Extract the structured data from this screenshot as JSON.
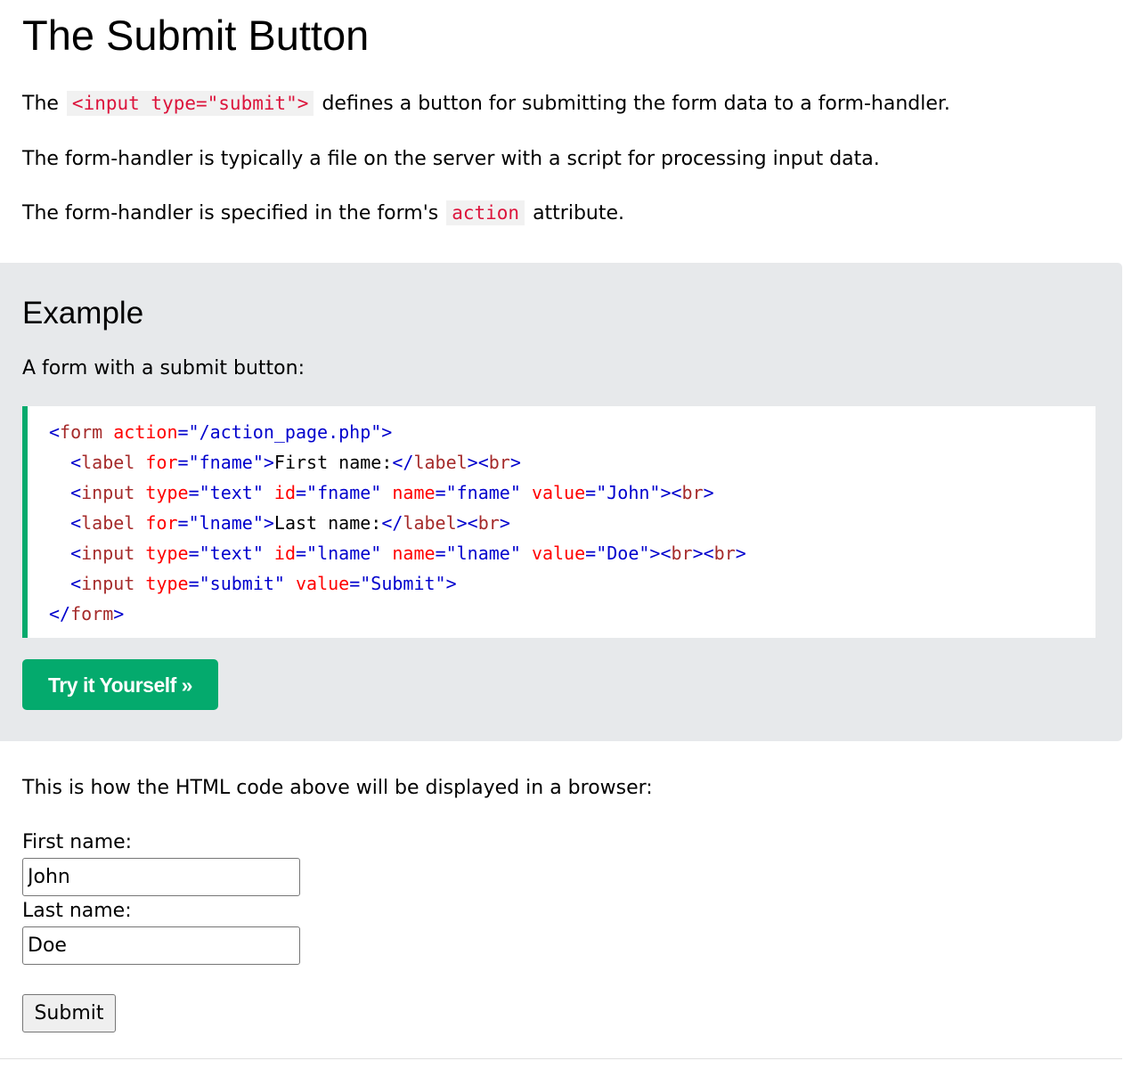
{
  "title": "The Submit Button",
  "intro": {
    "p1": {
      "before": "The",
      "code": "<input type=\"submit\">",
      "after": "defines a button for submitting the form data to a form-handler."
    },
    "p2": "The form-handler is typically a file on the server with a script for processing input data.",
    "p3": {
      "before": "The form-handler is specified in the form's",
      "code": "action",
      "after": "attribute."
    }
  },
  "example": {
    "heading": "Example",
    "description": "A form with a submit button:",
    "try_button": "Try it Yourself »",
    "code_lines": [
      {
        "indent": "",
        "tokens": [
          {
            "t": "tag",
            "v": "<"
          },
          {
            "t": "tname",
            "v": "form"
          },
          {
            "t": "text",
            "v": " "
          },
          {
            "t": "attr",
            "v": "action"
          },
          {
            "t": "tag",
            "v": "=\"/action_page.php\">"
          }
        ]
      },
      {
        "indent": "  ",
        "tokens": [
          {
            "t": "tag",
            "v": "<"
          },
          {
            "t": "tname",
            "v": "label"
          },
          {
            "t": "text",
            "v": " "
          },
          {
            "t": "attr",
            "v": "for"
          },
          {
            "t": "tag",
            "v": "=\"fname\">"
          },
          {
            "t": "text",
            "v": "First name:"
          },
          {
            "t": "tag",
            "v": "</"
          },
          {
            "t": "tname",
            "v": "label"
          },
          {
            "t": "tag",
            "v": "><"
          },
          {
            "t": "tname",
            "v": "br"
          },
          {
            "t": "tag",
            "v": ">"
          }
        ]
      },
      {
        "indent": "  ",
        "tokens": [
          {
            "t": "tag",
            "v": "<"
          },
          {
            "t": "tname",
            "v": "input"
          },
          {
            "t": "text",
            "v": " "
          },
          {
            "t": "attr",
            "v": "type"
          },
          {
            "t": "tag",
            "v": "=\"text\""
          },
          {
            "t": "text",
            "v": " "
          },
          {
            "t": "attr",
            "v": "id"
          },
          {
            "t": "tag",
            "v": "=\"fname\""
          },
          {
            "t": "text",
            "v": " "
          },
          {
            "t": "attr",
            "v": "name"
          },
          {
            "t": "tag",
            "v": "=\"fname\""
          },
          {
            "t": "text",
            "v": " "
          },
          {
            "t": "attr",
            "v": "value"
          },
          {
            "t": "tag",
            "v": "=\"John\"><"
          },
          {
            "t": "tname",
            "v": "br"
          },
          {
            "t": "tag",
            "v": ">"
          }
        ]
      },
      {
        "indent": "  ",
        "tokens": [
          {
            "t": "tag",
            "v": "<"
          },
          {
            "t": "tname",
            "v": "label"
          },
          {
            "t": "text",
            "v": " "
          },
          {
            "t": "attr",
            "v": "for"
          },
          {
            "t": "tag",
            "v": "=\"lname\">"
          },
          {
            "t": "text",
            "v": "Last name:"
          },
          {
            "t": "tag",
            "v": "</"
          },
          {
            "t": "tname",
            "v": "label"
          },
          {
            "t": "tag",
            "v": "><"
          },
          {
            "t": "tname",
            "v": "br"
          },
          {
            "t": "tag",
            "v": ">"
          }
        ]
      },
      {
        "indent": "  ",
        "tokens": [
          {
            "t": "tag",
            "v": "<"
          },
          {
            "t": "tname",
            "v": "input"
          },
          {
            "t": "text",
            "v": " "
          },
          {
            "t": "attr",
            "v": "type"
          },
          {
            "t": "tag",
            "v": "=\"text\""
          },
          {
            "t": "text",
            "v": " "
          },
          {
            "t": "attr",
            "v": "id"
          },
          {
            "t": "tag",
            "v": "=\"lname\""
          },
          {
            "t": "text",
            "v": " "
          },
          {
            "t": "attr",
            "v": "name"
          },
          {
            "t": "tag",
            "v": "=\"lname\""
          },
          {
            "t": "text",
            "v": " "
          },
          {
            "t": "attr",
            "v": "value"
          },
          {
            "t": "tag",
            "v": "=\"Doe\"><"
          },
          {
            "t": "tname",
            "v": "br"
          },
          {
            "t": "tag",
            "v": "><"
          },
          {
            "t": "tname",
            "v": "br"
          },
          {
            "t": "tag",
            "v": ">"
          }
        ]
      },
      {
        "indent": "  ",
        "tokens": [
          {
            "t": "tag",
            "v": "<"
          },
          {
            "t": "tname",
            "v": "input"
          },
          {
            "t": "text",
            "v": " "
          },
          {
            "t": "attr",
            "v": "type"
          },
          {
            "t": "tag",
            "v": "=\"submit\""
          },
          {
            "t": "text",
            "v": " "
          },
          {
            "t": "attr",
            "v": "value"
          },
          {
            "t": "tag",
            "v": "=\"Submit\">"
          }
        ]
      },
      {
        "indent": "",
        "tokens": [
          {
            "t": "tag",
            "v": "</"
          },
          {
            "t": "tname",
            "v": "form"
          },
          {
            "t": "tag",
            "v": ">"
          }
        ]
      }
    ]
  },
  "display_note": "This is how the HTML code above will be displayed in a browser:",
  "demo_form": {
    "first_label": "First name:",
    "first_value": "John",
    "last_label": "Last name:",
    "last_value": "Doe",
    "submit_label": "Submit"
  },
  "colors": {
    "accent_green": "#04aa6d",
    "inline_code_red": "#dc143c",
    "example_bg": "#e7e9eb",
    "code_tag_blue": "#0000cd",
    "code_tagname_brown": "#a52a2a",
    "code_attr_red": "#ff0000"
  }
}
